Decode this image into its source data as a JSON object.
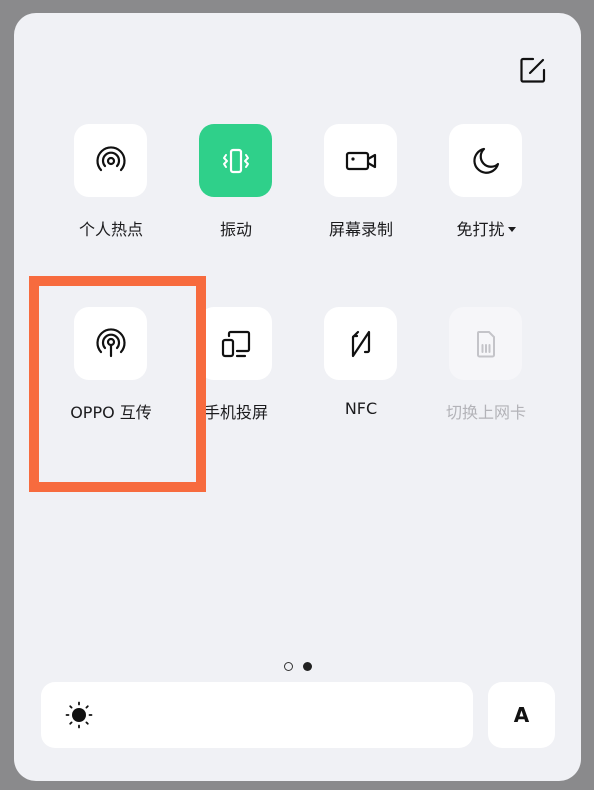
{
  "colors": {
    "active_tile": "#2fd08a",
    "highlight_border": "#f76b3e",
    "panel_bg": "#f0f1f5"
  },
  "tiles": [
    {
      "label": "个人热点",
      "icon": "hotspot-icon",
      "state": "off"
    },
    {
      "label": "振动",
      "icon": "vibrate-icon",
      "state": "on"
    },
    {
      "label": "屏幕录制",
      "icon": "screen-record-icon",
      "state": "off"
    },
    {
      "label": "免打扰",
      "icon": "moon-icon",
      "state": "off",
      "has_dropdown": true
    },
    {
      "label": "OPPO 互传",
      "icon": "oppo-share-icon",
      "state": "off"
    },
    {
      "label": "手机投屏",
      "icon": "screen-cast-icon",
      "state": "off"
    },
    {
      "label": "NFC",
      "icon": "nfc-icon",
      "state": "off"
    },
    {
      "label": "切换上网卡",
      "icon": "sim-card-icon",
      "state": "disabled"
    }
  ],
  "pager": {
    "count": 2,
    "current": 2
  },
  "brightness": {
    "icon": "sun-icon"
  },
  "auto_button": {
    "label": "A"
  },
  "edit_icon": "edit-icon"
}
